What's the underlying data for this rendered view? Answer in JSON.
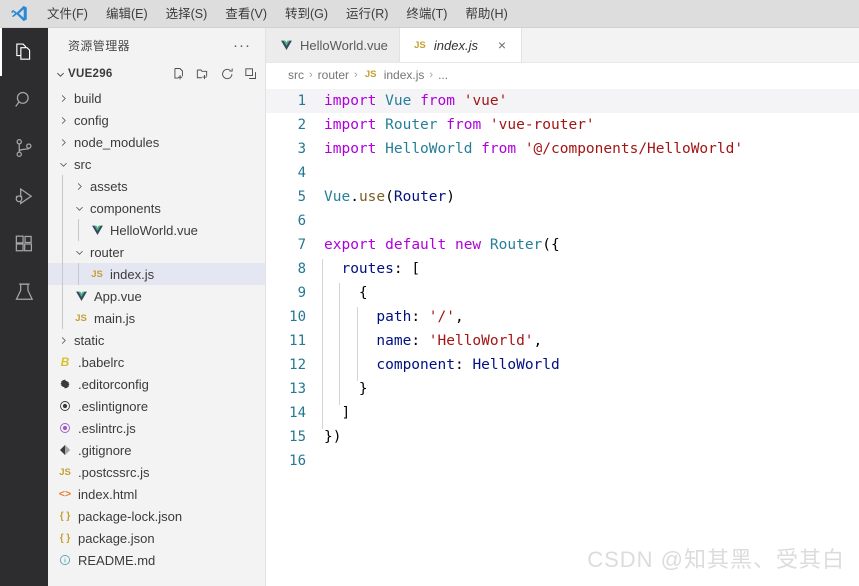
{
  "menubar": {
    "logo_name": "vscode-logo",
    "items": [
      {
        "label": "文件(F)"
      },
      {
        "label": "编辑(E)"
      },
      {
        "label": "选择(S)"
      },
      {
        "label": "查看(V)"
      },
      {
        "label": "转到(G)"
      },
      {
        "label": "运行(R)"
      },
      {
        "label": "终端(T)"
      },
      {
        "label": "帮助(H)"
      }
    ]
  },
  "activitybar": {
    "items": [
      {
        "name": "explorer-icon",
        "title": "资源管理器",
        "active": true
      },
      {
        "name": "search-icon",
        "title": "搜索",
        "active": false
      },
      {
        "name": "source-control-icon",
        "title": "源代码管理",
        "active": false
      },
      {
        "name": "run-debug-icon",
        "title": "运行和调试",
        "active": false
      },
      {
        "name": "extensions-icon",
        "title": "扩展",
        "active": false
      },
      {
        "name": "testing-icon",
        "title": "测试",
        "active": false
      }
    ]
  },
  "sidebar": {
    "title": "资源管理器",
    "more_label": "···",
    "project": {
      "name": "VUE296",
      "expanded": true,
      "actions": [
        "new-file-icon",
        "new-folder-icon",
        "refresh-icon",
        "collapse-all-icon"
      ]
    },
    "tree": [
      {
        "label": "build",
        "depth": 0,
        "type": "folder",
        "expanded": false,
        "icon": "",
        "color": ""
      },
      {
        "label": "config",
        "depth": 0,
        "type": "folder",
        "expanded": false,
        "icon": "",
        "color": ""
      },
      {
        "label": "node_modules",
        "depth": 0,
        "type": "folder",
        "expanded": false,
        "icon": "",
        "color": ""
      },
      {
        "label": "src",
        "depth": 0,
        "type": "folder",
        "expanded": true,
        "icon": "",
        "color": ""
      },
      {
        "label": "assets",
        "depth": 1,
        "type": "folder",
        "expanded": false,
        "icon": "",
        "color": ""
      },
      {
        "label": "components",
        "depth": 1,
        "type": "folder",
        "expanded": true,
        "icon": "",
        "color": ""
      },
      {
        "label": "HelloWorld.vue",
        "depth": 2,
        "type": "file",
        "icon": "vue",
        "color": "#41b883"
      },
      {
        "label": "router",
        "depth": 1,
        "type": "folder",
        "expanded": true,
        "icon": "",
        "color": ""
      },
      {
        "label": "index.js",
        "depth": 2,
        "type": "file",
        "icon": "JS",
        "color": "#c5a032",
        "selected": true
      },
      {
        "label": "App.vue",
        "depth": 1,
        "type": "file",
        "icon": "vue",
        "color": "#41b883"
      },
      {
        "label": "main.js",
        "depth": 1,
        "type": "file",
        "icon": "JS",
        "color": "#c5a032"
      },
      {
        "label": "static",
        "depth": 0,
        "type": "folder",
        "expanded": false,
        "icon": "",
        "color": ""
      },
      {
        "label": ".babelrc",
        "depth": 0,
        "type": "file",
        "icon": "babel",
        "color": "#d6c22e"
      },
      {
        "label": ".editorconfig",
        "depth": 0,
        "type": "file",
        "icon": "gear",
        "color": "#3b3b3b"
      },
      {
        "label": ".eslintignore",
        "depth": 0,
        "type": "file",
        "icon": "circle",
        "color": "#3b3b3b"
      },
      {
        "label": ".eslintrc.js",
        "depth": 0,
        "type": "file",
        "icon": "circle",
        "color": "#a05bc4"
      },
      {
        "label": ".gitignore",
        "depth": 0,
        "type": "file",
        "icon": "diamond",
        "color": "#3b3b3b"
      },
      {
        "label": ".postcssrc.js",
        "depth": 0,
        "type": "file",
        "icon": "JS",
        "color": "#c5a032"
      },
      {
        "label": "index.html",
        "depth": 0,
        "type": "file",
        "icon": "html",
        "color": "#e37933"
      },
      {
        "label": "package-lock.json",
        "depth": 0,
        "type": "file",
        "icon": "json",
        "color": "#c5a032"
      },
      {
        "label": "package.json",
        "depth": 0,
        "type": "file",
        "icon": "json",
        "color": "#c5a032"
      },
      {
        "label": "README.md",
        "depth": 0,
        "type": "file",
        "icon": "info",
        "color": "#519aba"
      }
    ]
  },
  "editor": {
    "tabs": [
      {
        "label": "HelloWorld.vue",
        "icon": "vue",
        "icon_color": "#41b883",
        "active": false,
        "closable": false
      },
      {
        "label": "index.js",
        "icon": "JS",
        "icon_color": "#c5a032",
        "active": true,
        "closable": true,
        "close_label": "×"
      }
    ],
    "breadcrumb": [
      "src",
      "router",
      "index.js",
      "..."
    ],
    "breadcrumb_icon": "JS",
    "breadcrumb_separator": "›",
    "current_line": 1,
    "lines": [
      {
        "n": 1,
        "tokens": [
          {
            "t": "import",
            "c": "kw"
          },
          {
            "t": " ",
            "c": "pun"
          },
          {
            "t": "Vue",
            "c": "type"
          },
          {
            "t": " ",
            "c": "pun"
          },
          {
            "t": "from",
            "c": "kw"
          },
          {
            "t": " ",
            "c": "pun"
          },
          {
            "t": "'vue'",
            "c": "str"
          }
        ],
        "indents": 0
      },
      {
        "n": 2,
        "tokens": [
          {
            "t": "import",
            "c": "kw"
          },
          {
            "t": " ",
            "c": "pun"
          },
          {
            "t": "Router",
            "c": "type"
          },
          {
            "t": " ",
            "c": "pun"
          },
          {
            "t": "from",
            "c": "kw"
          },
          {
            "t": " ",
            "c": "pun"
          },
          {
            "t": "'vue-router'",
            "c": "str"
          }
        ],
        "indents": 0
      },
      {
        "n": 3,
        "tokens": [
          {
            "t": "import",
            "c": "kw"
          },
          {
            "t": " ",
            "c": "pun"
          },
          {
            "t": "HelloWorld",
            "c": "type"
          },
          {
            "t": " ",
            "c": "pun"
          },
          {
            "t": "from",
            "c": "kw"
          },
          {
            "t": " ",
            "c": "pun"
          },
          {
            "t": "'@/components/HelloWorld'",
            "c": "str"
          }
        ],
        "indents": 0
      },
      {
        "n": 4,
        "tokens": [],
        "indents": 0
      },
      {
        "n": 5,
        "tokens": [
          {
            "t": "Vue",
            "c": "type"
          },
          {
            "t": ".",
            "c": "pun"
          },
          {
            "t": "use",
            "c": "fn"
          },
          {
            "t": "(",
            "c": "pun"
          },
          {
            "t": "Router",
            "c": "id"
          },
          {
            "t": ")",
            "c": "pun"
          }
        ],
        "indents": 0
      },
      {
        "n": 6,
        "tokens": [],
        "indents": 0
      },
      {
        "n": 7,
        "tokens": [
          {
            "t": "export",
            "c": "kw"
          },
          {
            "t": " ",
            "c": "pun"
          },
          {
            "t": "default",
            "c": "kw"
          },
          {
            "t": " ",
            "c": "pun"
          },
          {
            "t": "new",
            "c": "kw"
          },
          {
            "t": " ",
            "c": "pun"
          },
          {
            "t": "Router",
            "c": "type"
          },
          {
            "t": "({",
            "c": "pun"
          }
        ],
        "indents": 0
      },
      {
        "n": 8,
        "tokens": [
          {
            "t": "  ",
            "c": "pun"
          },
          {
            "t": "routes",
            "c": "id"
          },
          {
            "t": ": [",
            "c": "pun"
          }
        ],
        "indents": 1
      },
      {
        "n": 9,
        "tokens": [
          {
            "t": "    {",
            "c": "pun"
          }
        ],
        "indents": 2
      },
      {
        "n": 10,
        "tokens": [
          {
            "t": "      ",
            "c": "pun"
          },
          {
            "t": "path",
            "c": "id"
          },
          {
            "t": ": ",
            "c": "pun"
          },
          {
            "t": "'/'",
            "c": "str"
          },
          {
            "t": ",",
            "c": "pun"
          }
        ],
        "indents": 3
      },
      {
        "n": 11,
        "tokens": [
          {
            "t": "      ",
            "c": "pun"
          },
          {
            "t": "name",
            "c": "id"
          },
          {
            "t": ": ",
            "c": "pun"
          },
          {
            "t": "'HelloWorld'",
            "c": "str"
          },
          {
            "t": ",",
            "c": "pun"
          }
        ],
        "indents": 3
      },
      {
        "n": 12,
        "tokens": [
          {
            "t": "      ",
            "c": "pun"
          },
          {
            "t": "component",
            "c": "id"
          },
          {
            "t": ": ",
            "c": "pun"
          },
          {
            "t": "HelloWorld",
            "c": "id"
          }
        ],
        "indents": 3
      },
      {
        "n": 13,
        "tokens": [
          {
            "t": "    }",
            "c": "pun"
          }
        ],
        "indents": 2
      },
      {
        "n": 14,
        "tokens": [
          {
            "t": "  ]",
            "c": "pun"
          }
        ],
        "indents": 1
      },
      {
        "n": 15,
        "tokens": [
          {
            "t": "})",
            "c": "pun"
          }
        ],
        "indents": 0
      },
      {
        "n": 16,
        "tokens": [],
        "indents": 0
      }
    ]
  },
  "watermark": "CSDN @知其黑、受其白",
  "colors": {
    "activitybar_bg": "#2d2d30",
    "sidebar_bg": "#f3f3f3",
    "editor_bg": "#ffffff",
    "selection_bg": "#e4e6f1",
    "linenumber": "#237893",
    "keyword": "#af00db",
    "type": "#267f99",
    "string": "#a31515",
    "identifier": "#001080",
    "function": "#795e26"
  }
}
